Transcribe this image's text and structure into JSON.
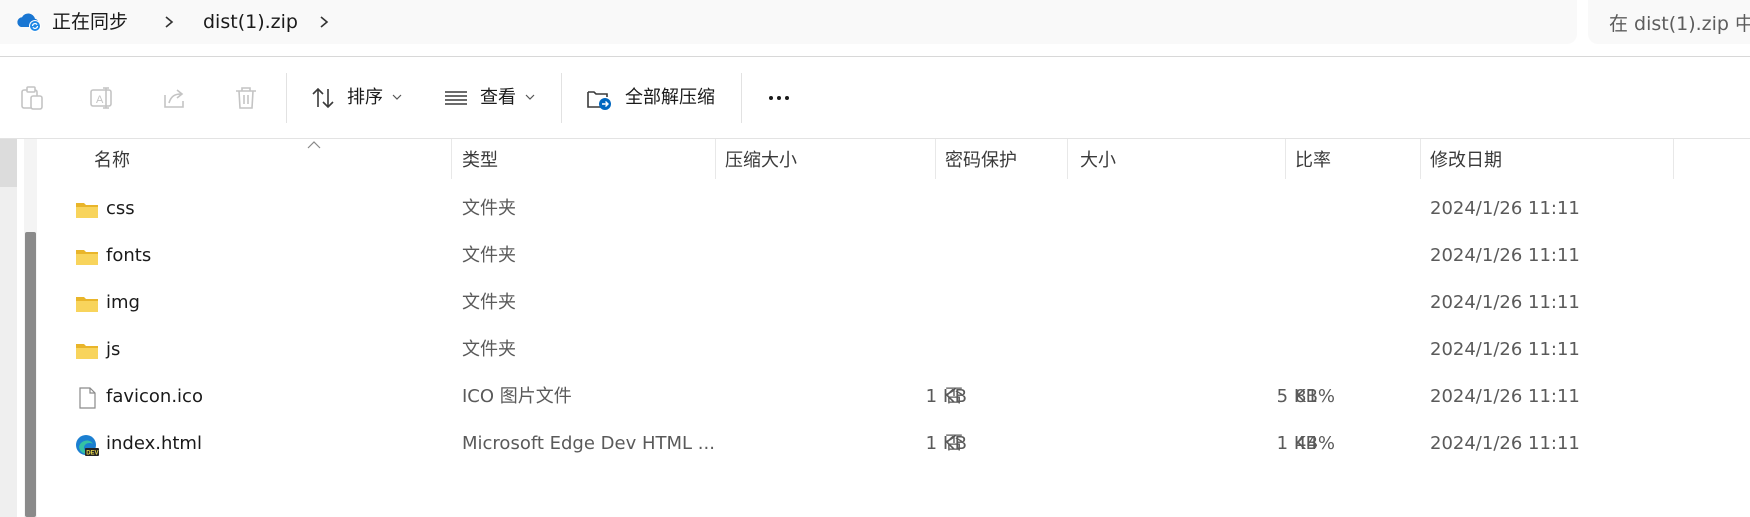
{
  "address_bar": {
    "location_icon": "cloud-sync-icon",
    "crumbs": [
      "正在同步",
      "dist(1).zip"
    ],
    "search_placeholder": "在 dist(1).zip 中"
  },
  "command_bar": {
    "icons": [
      "copy-icon",
      "rename-icon",
      "share-icon",
      "delete-icon"
    ],
    "sort_label": "排序",
    "view_label": "查看",
    "extract_label": "全部解压缩",
    "more_label": "···"
  },
  "columns": [
    "名称",
    "类型",
    "压缩大小",
    "密码保护",
    "大小",
    "比率",
    "修改日期"
  ],
  "files": [
    {
      "icon": "folder-icon",
      "name": "css",
      "type": "文件夹",
      "compressed": "",
      "password": "",
      "size": "",
      "ratio": "",
      "modified": "2024/1/26 11:11"
    },
    {
      "icon": "folder-icon",
      "name": "fonts",
      "type": "文件夹",
      "compressed": "",
      "password": "",
      "size": "",
      "ratio": "",
      "modified": "2024/1/26 11:11"
    },
    {
      "icon": "folder-icon",
      "name": "img",
      "type": "文件夹",
      "compressed": "",
      "password": "",
      "size": "",
      "ratio": "",
      "modified": "2024/1/26 11:11"
    },
    {
      "icon": "folder-icon",
      "name": "js",
      "type": "文件夹",
      "compressed": "",
      "password": "",
      "size": "",
      "ratio": "",
      "modified": "2024/1/26 11:11"
    },
    {
      "icon": "file-icon",
      "name": "favicon.ico",
      "type": "ICO 图片文件",
      "compressed": "1 KB",
      "password": "否",
      "size": "5 KB",
      "ratio": "81%",
      "modified": "2024/1/26 11:11"
    },
    {
      "icon": "edge-dev-icon",
      "name": "index.html",
      "type": "Microsoft Edge Dev HTML ...",
      "compressed": "1 KB",
      "password": "否",
      "size": "1 KB",
      "ratio": "44%",
      "modified": "2024/1/26 11:11"
    }
  ],
  "colors": {
    "folder": "#f5c842",
    "accent": "#0067c0"
  }
}
